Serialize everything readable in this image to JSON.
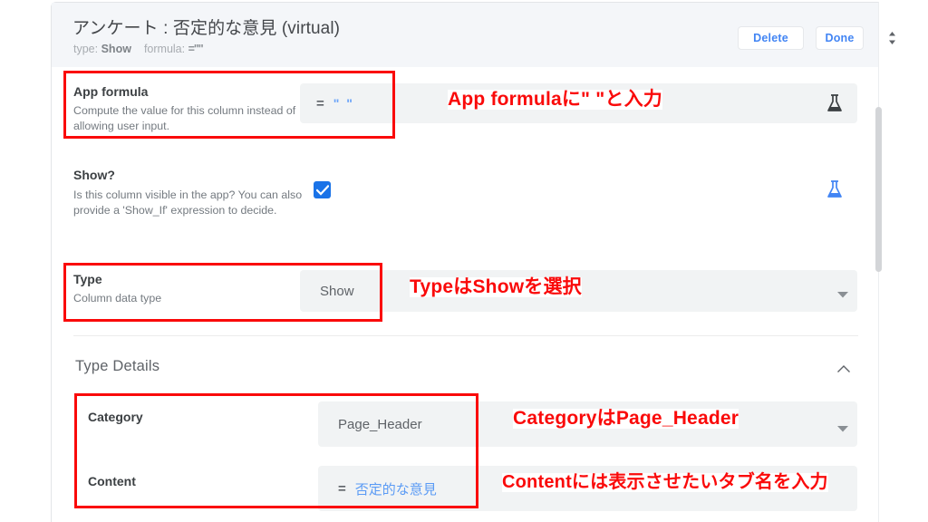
{
  "header": {
    "title": "アンケート : 否定的な意見 (virtual)",
    "meta_type_label": "type:",
    "meta_type_value": "Show",
    "meta_formula_label": "formula:",
    "meta_formula_value": "=\"\"",
    "delete_label": "Delete",
    "done_label": "Done",
    "stepper_icon": "up-down-chevron-icon",
    "accent_color": "#4285f4",
    "background_color": "#f4f6f9"
  },
  "rows": {
    "app_formula": {
      "label": "App formula",
      "description": "Compute the value for this column instead of allowing user input.",
      "equals_sign": "=",
      "value": "\" \"",
      "flask_icon": "flask-icon",
      "annotation": "App formulaに\" \"と入力"
    },
    "show": {
      "label": "Show?",
      "description": "Is this column visible in the app? You can also provide a 'Show_If' expression to decide.",
      "checked": true,
      "checkbox_color": "#1a73e8",
      "flask_icon": "flask-icon",
      "flask_color": "#4285f4"
    },
    "type": {
      "label": "Type",
      "description": "Column data type",
      "value": "Show",
      "annotation": "TypeはShowを選択",
      "caret_icon": "chevron-down-icon"
    }
  },
  "type_details": {
    "section_title": "Type Details",
    "collapse_icon": "chevron-up-icon",
    "category": {
      "label": "Category",
      "value": "Page_Header",
      "annotation": "CategoryはPage_Header",
      "caret_icon": "chevron-down-icon"
    },
    "content": {
      "label": "Content",
      "equals_sign": "=",
      "value": "否定的な意見",
      "annotation": "Contentには表示させたいタブ名を入力"
    }
  },
  "annotation_color": "#fa0a0a",
  "scrollbar": {
    "thumb_name": "vertical-scrollbar-thumb"
  }
}
